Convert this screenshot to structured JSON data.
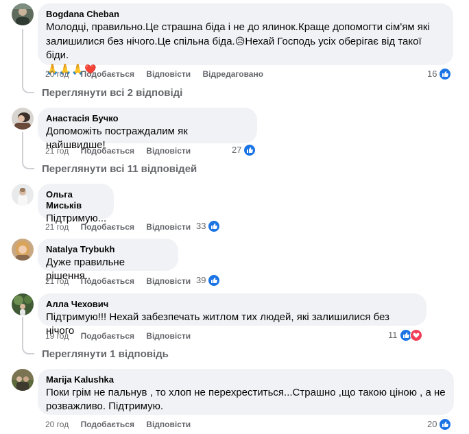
{
  "action_labels": {
    "like": "Подобається",
    "reply": "Відповісти",
    "edited": "Відредаговано"
  },
  "comments": [
    {
      "author": "Bogdana Cheban",
      "text_lines": [
        "Молодці, правильно.Це страшна біда і не до ялинок.Краще допомогти сім'ям які",
        "залишилися без нічого.Це спільна біда.",
        "Нехай Господь усіх оберігає від такої біди.",
        "🙏🙏🙏"
      ],
      "time": "20 год",
      "reactions": "16",
      "view_replies": "Переглянути всі 2 відповіді"
    },
    {
      "author": "Анастасія Бучко",
      "text_lines": [
        "Допоможіть постраждалим як найшвидше!"
      ],
      "time": "21 год",
      "reactions": "27",
      "view_replies": "Переглянути всі 11 відповідей"
    },
    {
      "author": "Ольга Миськів",
      "text_lines": [
        "Підтримую..."
      ],
      "time": "21 год",
      "reactions": "33"
    },
    {
      "author": "Natalya Trybukh",
      "text_lines": [
        "Дуже правильне рішення.."
      ],
      "time": "21 год",
      "reactions": "39"
    },
    {
      "author": "Алла Чехович",
      "text_lines": [
        "Підтримую!!! Нехай забезпечать житлом тих людей, які залишилися без нічого"
      ],
      "time": "19 год",
      "reactions": "11",
      "view_replies": "Переглянути 1 відповідь"
    },
    {
      "author": "Marija Kalushka",
      "text_lines": [
        "Поки грім не пальнув , то хлоп не перехреститься...Страшно ,що такою ціною , а не",
        "розважливо. Підтримую."
      ],
      "time": "20 год",
      "reactions": "20"
    }
  ],
  "icons": {
    "like": "like-icon",
    "love": "love-icon",
    "sad": "sad-emoji",
    "pray": "pray-emoji",
    "heart": "heart-emoji"
  },
  "colors": {
    "bubble": "#f0f2f5",
    "meta": "#65676b",
    "like": "#1b74e4",
    "love": "#f33e58"
  }
}
